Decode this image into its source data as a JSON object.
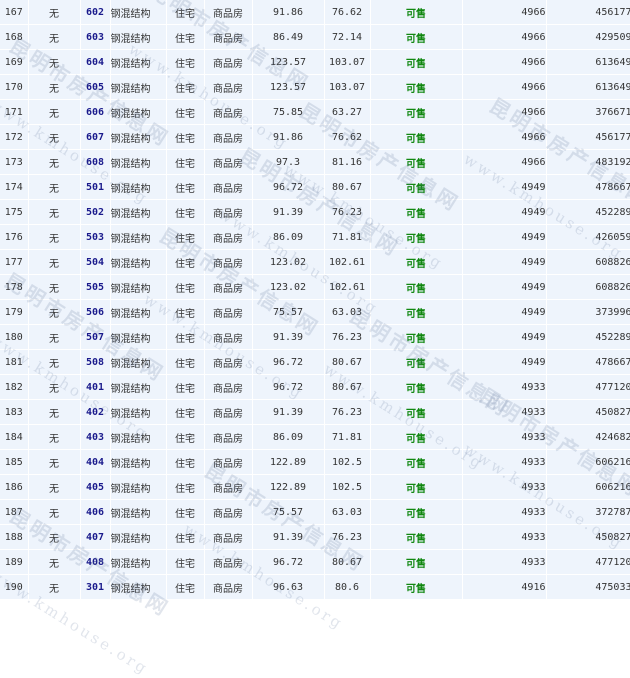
{
  "colors": {
    "cell_bg": "#eef4fc",
    "grid": "#ffffff",
    "room_text": "#1a1a8c",
    "status_text": "#118811"
  },
  "watermark": {
    "cn": "昆明市房产信息网",
    "en": "www.kmhouse.org"
  },
  "rows": [
    {
      "no": "167",
      "flag": "无",
      "room": "602",
      "structure": "钢混结构",
      "use": "住宅",
      "type": "商品房",
      "area": "91.86",
      "inner": "76.62",
      "status": "可售",
      "price": "4966",
      "total": "456177"
    },
    {
      "no": "168",
      "flag": "无",
      "room": "603",
      "structure": "钢混结构",
      "use": "住宅",
      "type": "商品房",
      "area": "86.49",
      "inner": "72.14",
      "status": "可售",
      "price": "4966",
      "total": "429509"
    },
    {
      "no": "169",
      "flag": "无",
      "room": "604",
      "structure": "钢混结构",
      "use": "住宅",
      "type": "商品房",
      "area": "123.57",
      "inner": "103.07",
      "status": "可售",
      "price": "4966",
      "total": "613649"
    },
    {
      "no": "170",
      "flag": "无",
      "room": "605",
      "structure": "钢混结构",
      "use": "住宅",
      "type": "商品房",
      "area": "123.57",
      "inner": "103.07",
      "status": "可售",
      "price": "4966",
      "total": "613649"
    },
    {
      "no": "171",
      "flag": "无",
      "room": "606",
      "structure": "钢混结构",
      "use": "住宅",
      "type": "商品房",
      "area": "75.85",
      "inner": "63.27",
      "status": "可售",
      "price": "4966",
      "total": "376671"
    },
    {
      "no": "172",
      "flag": "无",
      "room": "607",
      "structure": "钢混结构",
      "use": "住宅",
      "type": "商品房",
      "area": "91.86",
      "inner": "76.62",
      "status": "可售",
      "price": "4966",
      "total": "456177"
    },
    {
      "no": "173",
      "flag": "无",
      "room": "608",
      "structure": "钢混结构",
      "use": "住宅",
      "type": "商品房",
      "area": "97.3",
      "inner": "81.16",
      "status": "可售",
      "price": "4966",
      "total": "483192"
    },
    {
      "no": "174",
      "flag": "无",
      "room": "501",
      "structure": "钢混结构",
      "use": "住宅",
      "type": "商品房",
      "area": "96.72",
      "inner": "80.67",
      "status": "可售",
      "price": "4949",
      "total": "478667"
    },
    {
      "no": "175",
      "flag": "无",
      "room": "502",
      "structure": "钢混结构",
      "use": "住宅",
      "type": "商品房",
      "area": "91.39",
      "inner": "76.23",
      "status": "可售",
      "price": "4949",
      "total": "452289"
    },
    {
      "no": "176",
      "flag": "无",
      "room": "503",
      "structure": "钢混结构",
      "use": "住宅",
      "type": "商品房",
      "area": "86.09",
      "inner": "71.81",
      "status": "可售",
      "price": "4949",
      "total": "426059"
    },
    {
      "no": "177",
      "flag": "无",
      "room": "504",
      "structure": "钢混结构",
      "use": "住宅",
      "type": "商品房",
      "area": "123.02",
      "inner": "102.61",
      "status": "可售",
      "price": "4949",
      "total": "608826"
    },
    {
      "no": "178",
      "flag": "无",
      "room": "505",
      "structure": "钢混结构",
      "use": "住宅",
      "type": "商品房",
      "area": "123.02",
      "inner": "102.61",
      "status": "可售",
      "price": "4949",
      "total": "608826"
    },
    {
      "no": "179",
      "flag": "无",
      "room": "506",
      "structure": "钢混结构",
      "use": "住宅",
      "type": "商品房",
      "area": "75.57",
      "inner": "63.03",
      "status": "可售",
      "price": "4949",
      "total": "373996"
    },
    {
      "no": "180",
      "flag": "无",
      "room": "507",
      "structure": "钢混结构",
      "use": "住宅",
      "type": "商品房",
      "area": "91.39",
      "inner": "76.23",
      "status": "可售",
      "price": "4949",
      "total": "452289"
    },
    {
      "no": "181",
      "flag": "无",
      "room": "508",
      "structure": "钢混结构",
      "use": "住宅",
      "type": "商品房",
      "area": "96.72",
      "inner": "80.67",
      "status": "可售",
      "price": "4949",
      "total": "478667"
    },
    {
      "no": "182",
      "flag": "无",
      "room": "401",
      "structure": "钢混结构",
      "use": "住宅",
      "type": "商品房",
      "area": "96.72",
      "inner": "80.67",
      "status": "可售",
      "price": "4933",
      "total": "477120"
    },
    {
      "no": "183",
      "flag": "无",
      "room": "402",
      "structure": "钢混结构",
      "use": "住宅",
      "type": "商品房",
      "area": "91.39",
      "inner": "76.23",
      "status": "可售",
      "price": "4933",
      "total": "450827"
    },
    {
      "no": "184",
      "flag": "无",
      "room": "403",
      "structure": "钢混结构",
      "use": "住宅",
      "type": "商品房",
      "area": "86.09",
      "inner": "71.81",
      "status": "可售",
      "price": "4933",
      "total": "424682"
    },
    {
      "no": "185",
      "flag": "无",
      "room": "404",
      "structure": "钢混结构",
      "use": "住宅",
      "type": "商品房",
      "area": "122.89",
      "inner": "102.5",
      "status": "可售",
      "price": "4933",
      "total": "606216"
    },
    {
      "no": "186",
      "flag": "无",
      "room": "405",
      "structure": "钢混结构",
      "use": "住宅",
      "type": "商品房",
      "area": "122.89",
      "inner": "102.5",
      "status": "可售",
      "price": "4933",
      "total": "606216"
    },
    {
      "no": "187",
      "flag": "无",
      "room": "406",
      "structure": "钢混结构",
      "use": "住宅",
      "type": "商品房",
      "area": "75.57",
      "inner": "63.03",
      "status": "可售",
      "price": "4933",
      "total": "372787"
    },
    {
      "no": "188",
      "flag": "无",
      "room": "407",
      "structure": "钢混结构",
      "use": "住宅",
      "type": "商品房",
      "area": "91.39",
      "inner": "76.23",
      "status": "可售",
      "price": "4933",
      "total": "450827"
    },
    {
      "no": "189",
      "flag": "无",
      "room": "408",
      "structure": "钢混结构",
      "use": "住宅",
      "type": "商品房",
      "area": "96.72",
      "inner": "80.67",
      "status": "可售",
      "price": "4933",
      "total": "477120"
    },
    {
      "no": "190",
      "flag": "无",
      "room": "301",
      "structure": "钢混结构",
      "use": "住宅",
      "type": "商品房",
      "area": "96.63",
      "inner": "80.6",
      "status": "可售",
      "price": "4916",
      "total": "475033"
    }
  ]
}
